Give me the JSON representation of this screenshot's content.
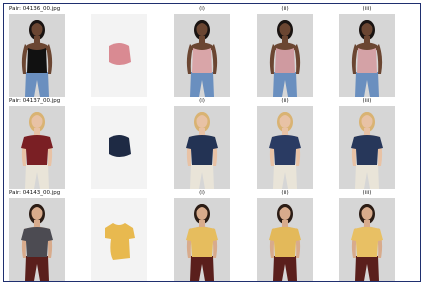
{
  "figure": {
    "rows": [
      {
        "pair_label": "Pair: 04136_00.jpg",
        "col_labels": [
          "(i)",
          "(ii)",
          "(iii)"
        ],
        "person": {
          "top_color": "#111111",
          "skin": "#6b4632",
          "hair": "#1a1412",
          "bottom_color": "#6a8fbf",
          "top_style": "camisole"
        },
        "garment": {
          "color": "#d98a92",
          "shape": "camisole"
        },
        "results": [
          {
            "top_color": "#d9a5a8"
          },
          {
            "top_color": "#cf9aa0"
          },
          {
            "top_color": "#d4a2a6"
          }
        ]
      },
      {
        "pair_label": "Pair: 04137_00.jpg",
        "col_labels": [
          "(i)",
          "(ii)",
          "(iii)"
        ],
        "person": {
          "top_color": "#7a1f24",
          "skin": "#e8c2a5",
          "hair": "#d9b373",
          "bottom_color": "#e9e4d8",
          "top_style": "tshirt"
        },
        "garment": {
          "color": "#1e2a44",
          "shape": "camisole"
        },
        "results": [
          {
            "top_color": "#233354"
          },
          {
            "top_color": "#2a3b63"
          },
          {
            "top_color": "#27375a"
          }
        ]
      },
      {
        "pair_label": "Pair: 04143_00.jpg",
        "col_labels": [
          "(i)",
          "(ii)",
          "(iii)"
        ],
        "person": {
          "top_color": "#4c4b52",
          "skin": "#d8ab8c",
          "hair": "#2b1c15",
          "bottom_color": "#5a1f1c",
          "top_style": "tshirt"
        },
        "garment": {
          "color": "#e8b94f",
          "shape": "tshirt"
        },
        "results": [
          {
            "top_color": "#e6bd5e"
          },
          {
            "top_color": "#e3b95a"
          },
          {
            "top_color": "#e8c064"
          }
        ]
      }
    ],
    "colors": {
      "background_photo": "#d6d6d6",
      "garment_bg": "#f3f3f3",
      "border": "#1f2f6f"
    }
  }
}
